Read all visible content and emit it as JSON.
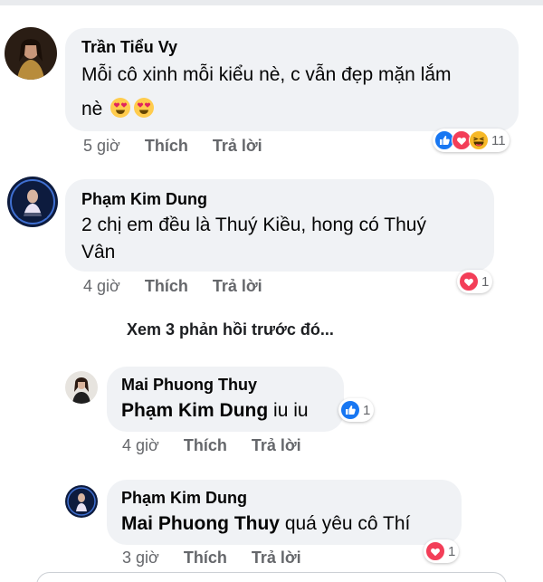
{
  "comments": [
    {
      "author": "Trần Tiểu Vy",
      "line1": "Mỗi cô xinh mỗi kiểu nè, c vẫn đẹp mặn lắm",
      "line2": "nè",
      "emoji": "heart-eyes-emoji",
      "time": "5 giờ",
      "like": "Thích",
      "reply": "Trả lời",
      "reactions": [
        "like",
        "love",
        "haha"
      ],
      "reaction_count": "11"
    },
    {
      "author": "Phạm Kim Dung",
      "line1": "2 chị em đều là Thuý Kiều, hong có Thuý",
      "line2": "Vân",
      "time": "4 giờ",
      "like": "Thích",
      "reply": "Trả lời",
      "reactions": [
        "love"
      ],
      "reaction_count": "1"
    }
  ],
  "more_replies": "Xem 3 phản hồi trước đó...",
  "replies": [
    {
      "author": "Mai Phuong Thuy",
      "mention": "Phạm Kim Dung",
      "text": " iu iu",
      "time": "4 giờ",
      "like": "Thích",
      "reply": "Trả lời",
      "reactions": [
        "like"
      ],
      "reaction_count": "1"
    },
    {
      "author": "Phạm Kim Dung",
      "mention": "Mai Phuong Thuy",
      "text": " quá yêu cô Thí",
      "time": "3 giờ",
      "like": "Thích",
      "reply": "Trả lời",
      "reactions": [
        "love"
      ],
      "reaction_count": "1"
    }
  ],
  "colors": {
    "bubble": "#f0f2f5",
    "like_blue": "#1877f2",
    "love_red": "#f33e58",
    "haha_yellow": "#f7b928",
    "meta_gray": "#65676b"
  }
}
